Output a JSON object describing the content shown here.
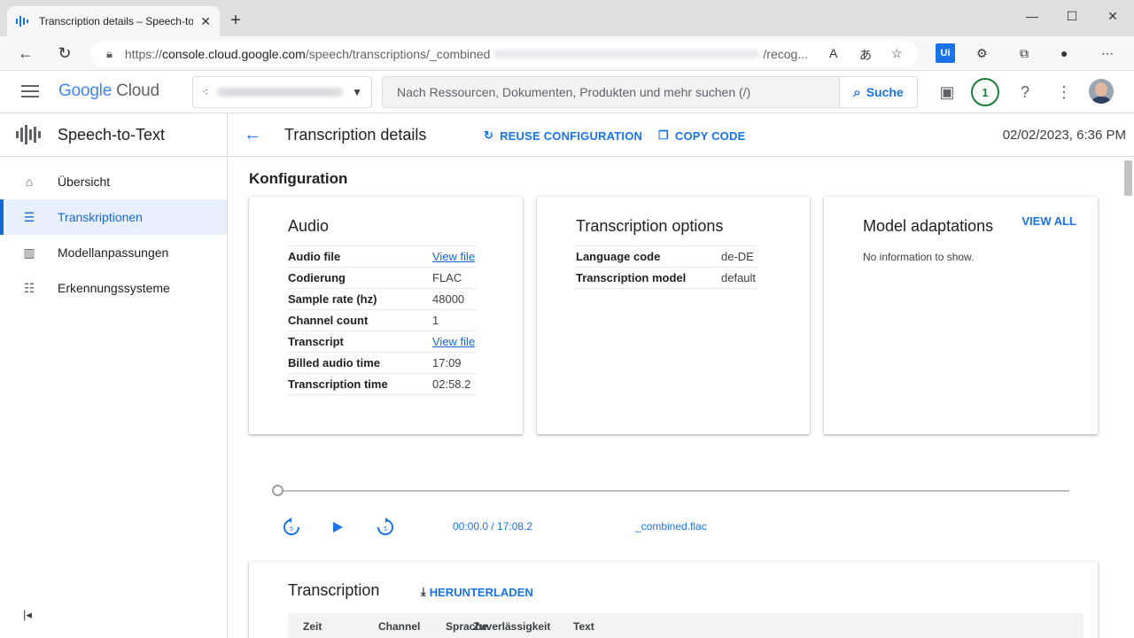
{
  "browser": {
    "tab_title": "Transcription details – Speech-to",
    "url_prefix": "https://",
    "url_host": "console.cloud.google.com",
    "url_path": "/speech/transcriptions/_combined",
    "url_tail": "/recog..."
  },
  "header": {
    "logo_google": "Google",
    "logo_cloud": "Cloud",
    "search_placeholder": "Nach Ressourcen, Dokumenten, Produkten und mehr suchen (/)",
    "search_button": "Suche",
    "notification_count": "1"
  },
  "sidebar": {
    "product": "Speech-to-Text",
    "items": [
      {
        "label": "Übersicht",
        "icon": "home-icon",
        "active": false
      },
      {
        "label": "Transkriptionen",
        "icon": "list-icon",
        "active": true
      },
      {
        "label": "Modellanpassungen",
        "icon": "bars-icon",
        "active": false
      },
      {
        "label": "Erkennungssysteme",
        "icon": "grid-list-icon",
        "active": false
      }
    ]
  },
  "page": {
    "title": "Transcription details",
    "reuse_label": "REUSE CONFIGURATION",
    "copy_label": "COPY CODE",
    "timestamp": "02/02/2023, 6:36 PM",
    "section_title": "Konfiguration"
  },
  "audio": {
    "title": "Audio",
    "rows": [
      {
        "key": "Audio file",
        "value": "View file",
        "link": true
      },
      {
        "key": "Codierung",
        "value": "FLAC",
        "link": false
      },
      {
        "key": "Sample rate (hz)",
        "value": "48000",
        "link": false
      },
      {
        "key": "Channel count",
        "value": "1",
        "link": false
      },
      {
        "key": "Transcript",
        "value": "View file",
        "link": true
      },
      {
        "key": "Billed audio time",
        "value": "17:09",
        "link": false
      },
      {
        "key": "Transcription time",
        "value": "02:58.2",
        "link": false
      }
    ]
  },
  "options": {
    "title": "Transcription options",
    "rows": [
      {
        "key": "Language code",
        "value": "de-DE"
      },
      {
        "key": "Transcription model",
        "value": "default"
      }
    ]
  },
  "adaptations": {
    "title": "Model adaptations",
    "view_all": "VIEW ALL",
    "empty": "No information to show."
  },
  "player": {
    "time": "00:00.0 / 17:08.2",
    "file": "_combined.flac",
    "progress": 0
  },
  "transcription": {
    "title": "Transcription",
    "download": "HERUNTERLADEN",
    "columns": [
      "Zeit",
      "Channel",
      "Sprache",
      "Zuverlässigkeit",
      "Text"
    ]
  }
}
